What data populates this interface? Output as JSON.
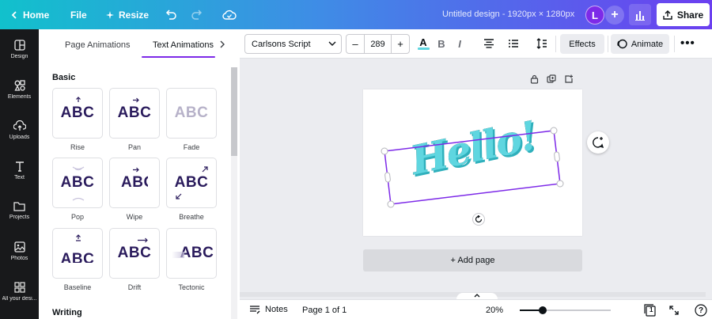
{
  "topbar": {
    "home_label": "Home",
    "file_label": "File",
    "resize_label": "Resize",
    "design_title": "Untitled design - 1920px × 1280px",
    "avatar_initial": "L",
    "plus_label": "+",
    "share_label": "Share"
  },
  "rail": {
    "items": [
      {
        "label": "Design",
        "icon": "design-icon"
      },
      {
        "label": "Elements",
        "icon": "elements-icon"
      },
      {
        "label": "Uploads",
        "icon": "upload-icon"
      },
      {
        "label": "Text",
        "icon": "text-icon"
      },
      {
        "label": "Projects",
        "icon": "folder-icon"
      },
      {
        "label": "Photos",
        "icon": "photo-icon"
      },
      {
        "label": "All your desi...",
        "icon": "apps-icon"
      }
    ]
  },
  "panel": {
    "tab_page": "Page Animations",
    "tab_text": "Text Animations",
    "section_basic": "Basic",
    "section_writing": "Writing",
    "card_text": "ABC",
    "cards": [
      {
        "label": "Rise"
      },
      {
        "label": "Pan"
      },
      {
        "label": "Fade"
      },
      {
        "label": "Pop"
      },
      {
        "label": "Wipe"
      },
      {
        "label": "Breathe"
      },
      {
        "label": "Baseline"
      },
      {
        "label": "Drift"
      },
      {
        "label": "Tectonic"
      }
    ]
  },
  "toolbar": {
    "font_name": "Carlsons Script",
    "size_minus": "–",
    "font_size": "289",
    "size_plus": "+",
    "color_label": "A",
    "bold_label": "B",
    "italic_label": "I",
    "effects_label": "Effects",
    "animate_label": "Animate",
    "more_label": "•••"
  },
  "canvas": {
    "text_content": "Hello!",
    "text_color": "#5fd6e0",
    "selection_color": "#7d2ae8",
    "add_page_label": "+ Add page"
  },
  "bottombar": {
    "notes_label": "Notes",
    "page_label": "Page 1 of 1",
    "zoom_label": "20%",
    "zoom_level": 0.25,
    "page_count": "1",
    "help_label": "?"
  }
}
